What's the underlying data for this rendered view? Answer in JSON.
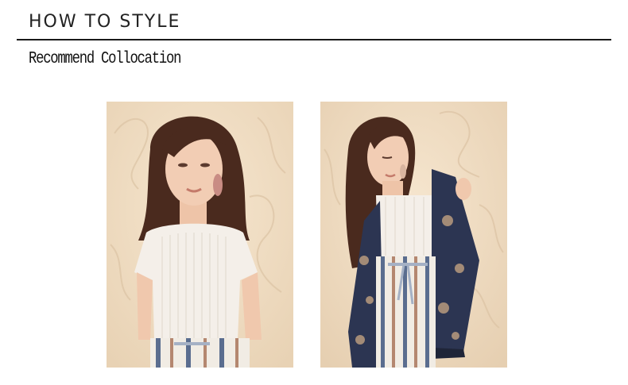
{
  "header": {
    "title": "HOW TO STYLE"
  },
  "section": {
    "subtitle": "Recommend Collocation"
  },
  "photos": [
    {
      "name": "model-white-ribbed-tee",
      "alt": "Model in white ribbed short-sleeve top with striped pants"
    },
    {
      "name": "model-tee-with-kimono",
      "alt": "Model in white top, navy floral kimono and striped pants"
    }
  ],
  "colors": {
    "background_wall": "#efdcc2",
    "hair": "#4a2a1e",
    "skin": "#f2cdb4",
    "top": "#f4efe9",
    "kimono": "#2c3552",
    "stripe_blue": "#5a6d8f",
    "stripe_rust": "#b48770"
  }
}
